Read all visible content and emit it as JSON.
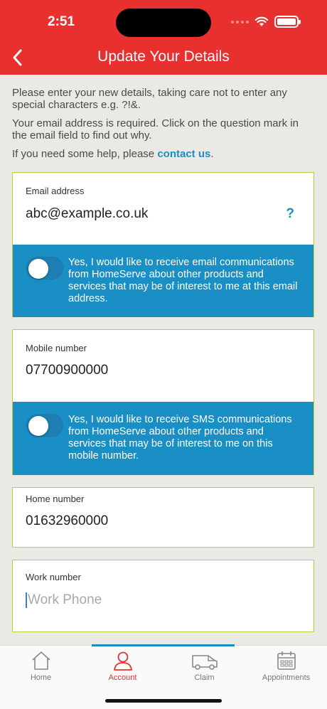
{
  "status_bar": {
    "time": "2:51"
  },
  "header": {
    "title": "Update Your Details"
  },
  "intro": {
    "paragraph1": "Please enter your new details, taking care not to enter any special characters e.g. ?!&.",
    "paragraph2": "Your email address is required. Click on the question mark in the email field to find out why.",
    "help_prefix": "If you need some help, please ",
    "help_link": "contact us",
    "help_suffix": "."
  },
  "email": {
    "label": "Email address",
    "value": "abc@example.co.uk",
    "help_symbol": "?",
    "optin_text": "Yes, I would like to receive email communications from HomeServe about other products and services that may be of interest to me at this email address."
  },
  "mobile": {
    "label": "Mobile number",
    "value": "07700900000",
    "optin_text": "Yes, I would like to receive SMS communications from HomeServe about other products and services that may be of interest to me on this mobile number."
  },
  "home": {
    "label": "Home number",
    "value": "01632960000"
  },
  "work": {
    "label": "Work number",
    "value": "",
    "placeholder": "Work Phone"
  },
  "tabs": [
    {
      "label": "Home",
      "icon": "house-icon"
    },
    {
      "label": "Account",
      "icon": "person-icon",
      "active": true
    },
    {
      "label": "Claim",
      "icon": "van-icon"
    },
    {
      "label": "Appointments",
      "icon": "calendar-icon"
    }
  ],
  "colors": {
    "brand_red": "#e8312f",
    "accent_blue": "#1a8fc6",
    "field_border": "#b6d03b"
  }
}
